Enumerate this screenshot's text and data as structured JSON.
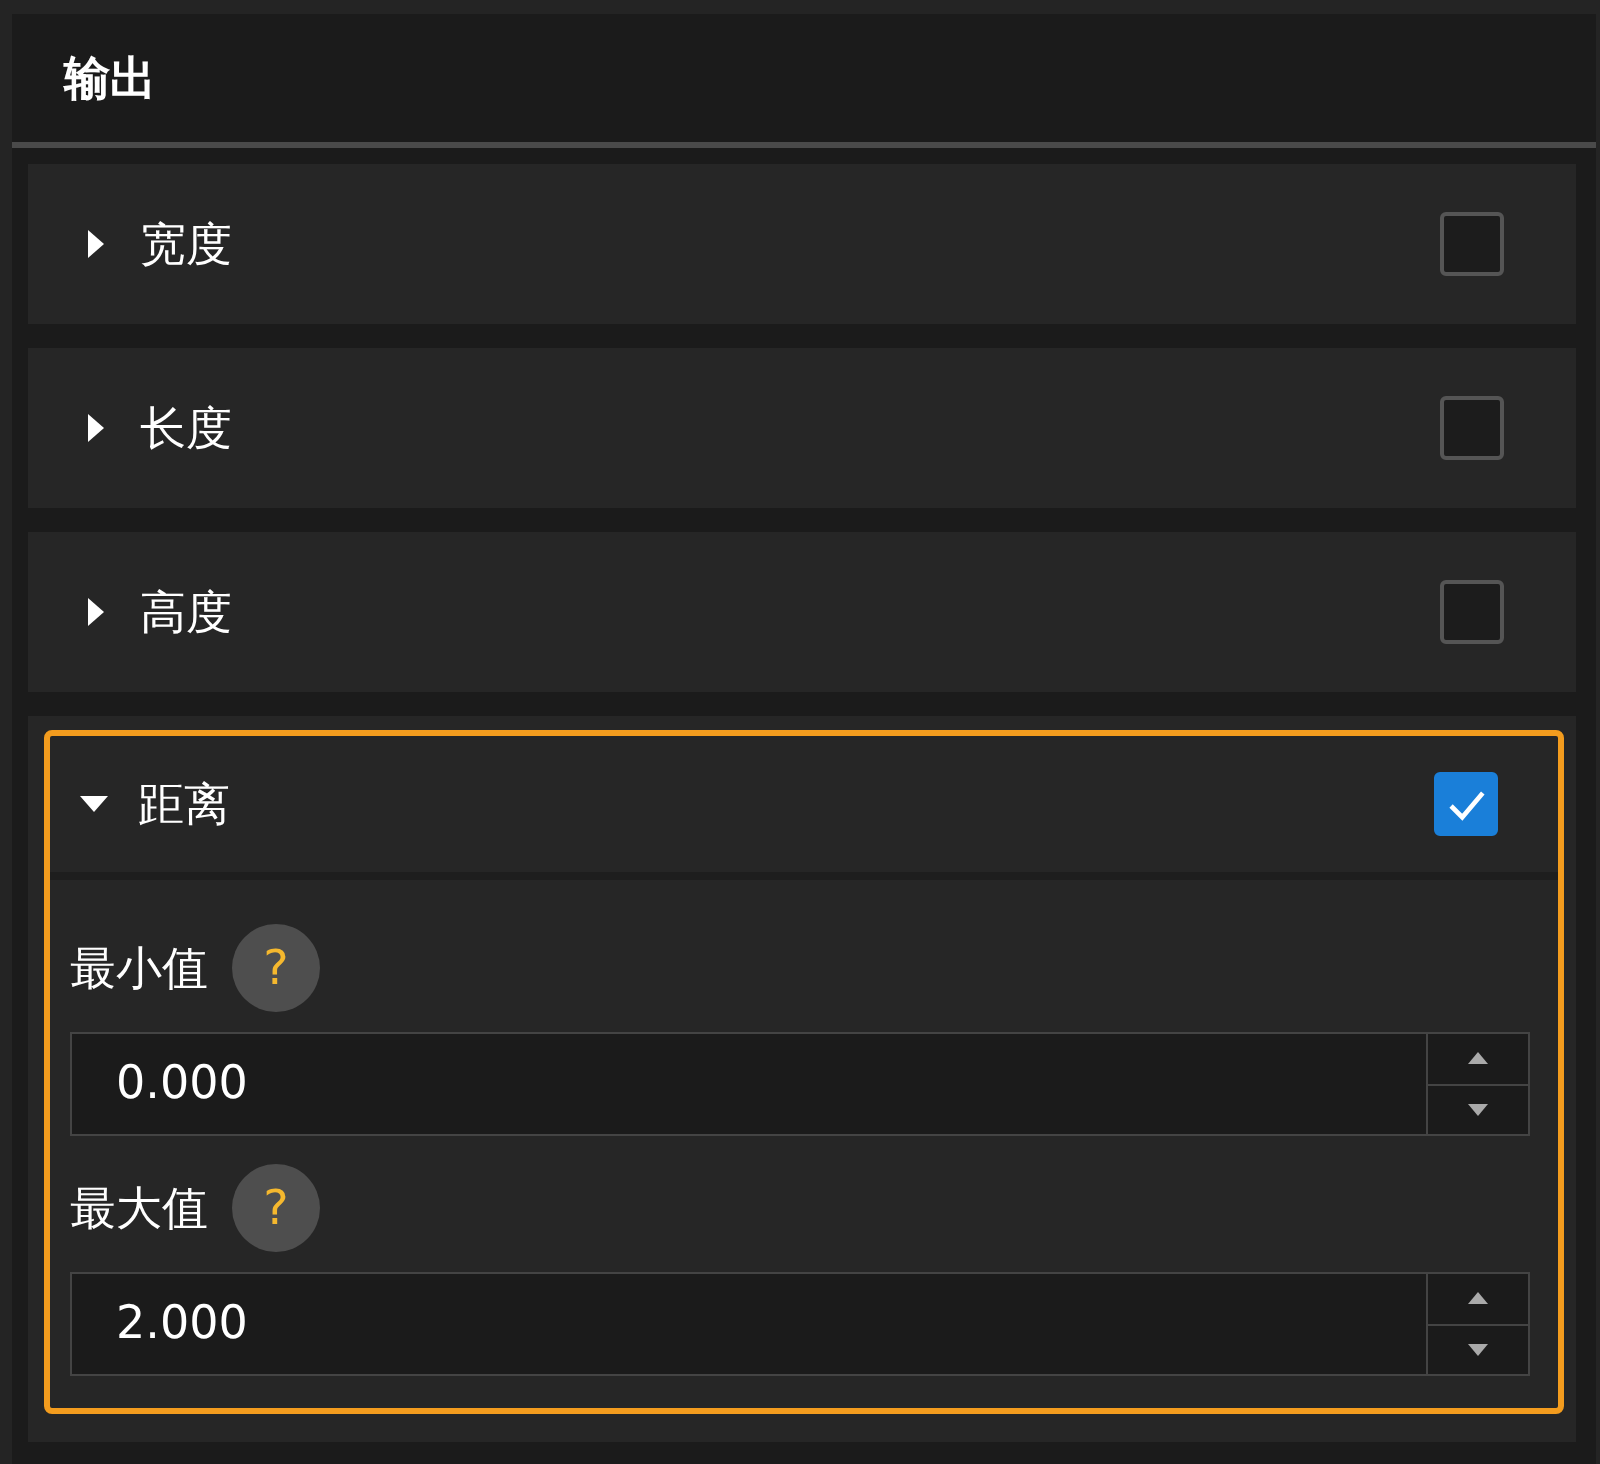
{
  "panel": {
    "title": "输出"
  },
  "sections": [
    {
      "label": "宽度",
      "expanded": false,
      "checked": false,
      "highlighted": false
    },
    {
      "label": "长度",
      "expanded": false,
      "checked": false,
      "highlighted": false
    },
    {
      "label": "高度",
      "expanded": false,
      "checked": false,
      "highlighted": false
    },
    {
      "label": "距离",
      "expanded": true,
      "checked": true,
      "highlighted": true,
      "fields": [
        {
          "label": "最小值",
          "help": "?",
          "value": "0.000"
        },
        {
          "label": "最大值",
          "help": "?",
          "value": "2.000"
        }
      ]
    }
  ]
}
